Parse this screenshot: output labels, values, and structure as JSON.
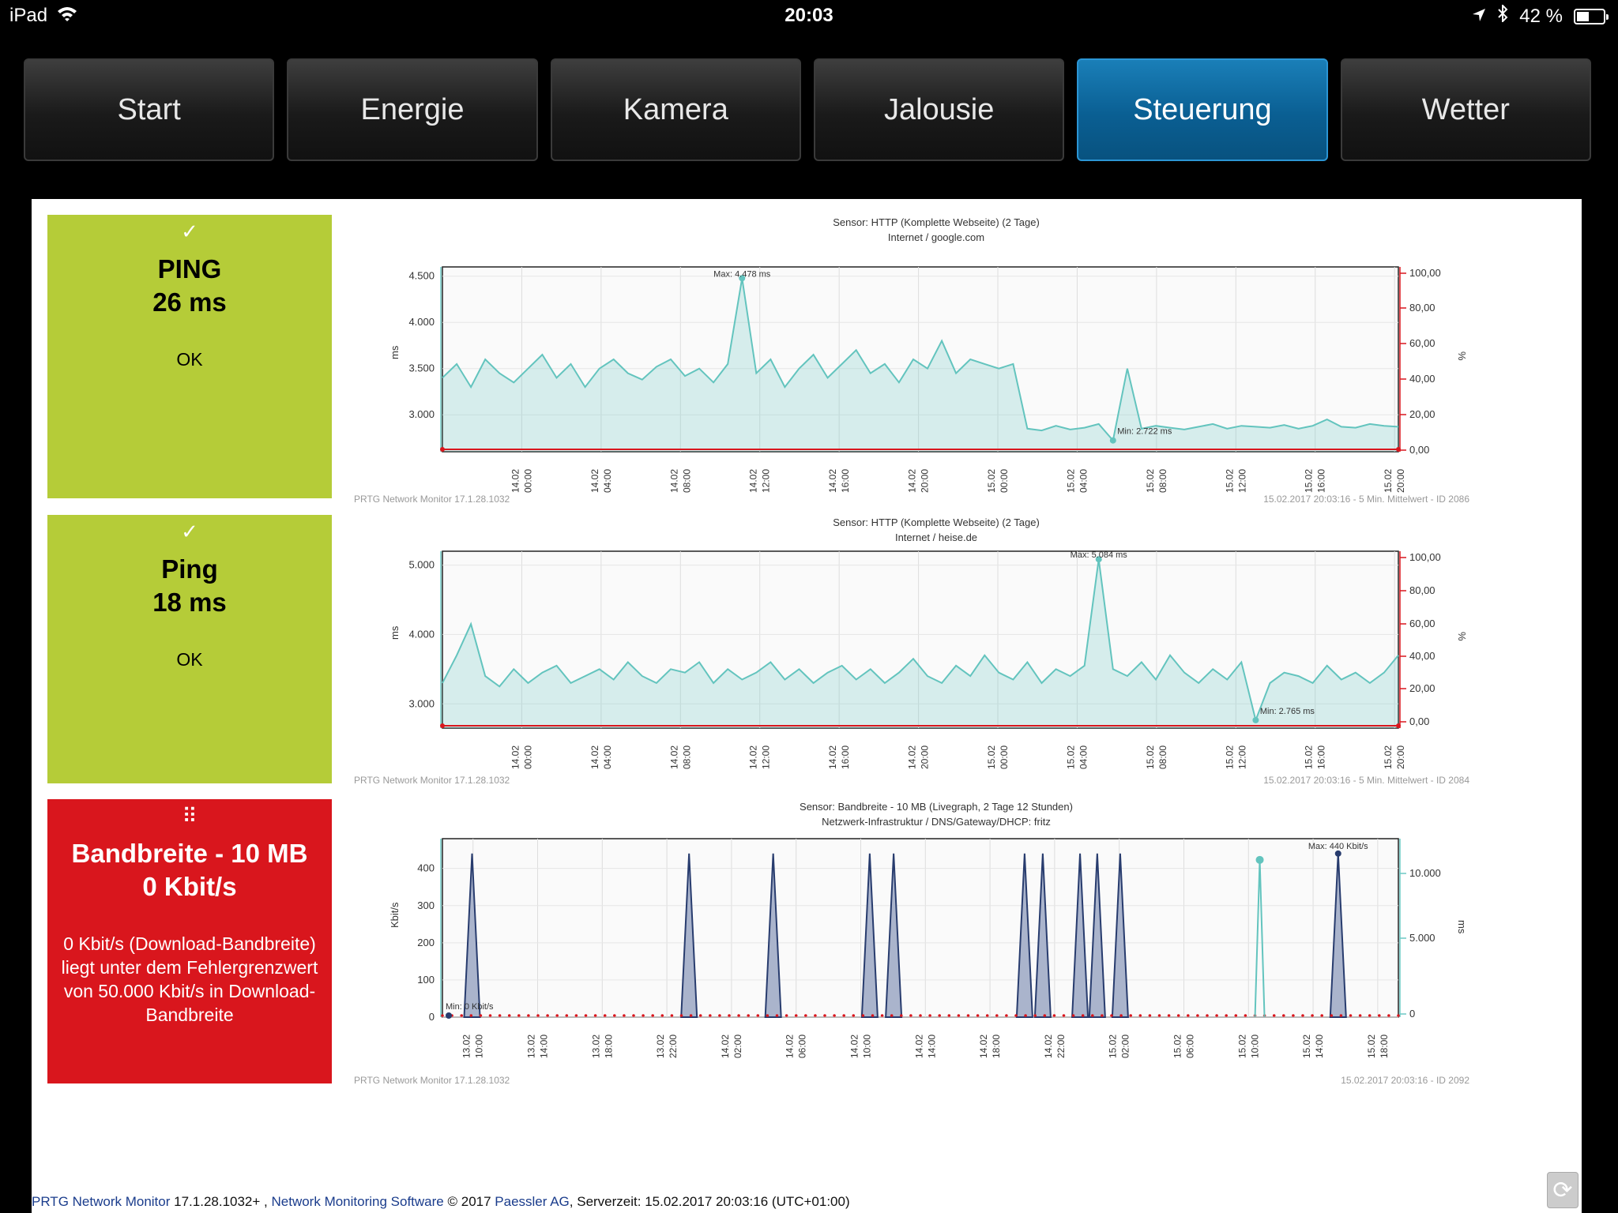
{
  "statusbar": {
    "device": "iPad",
    "time": "20:03",
    "battery": "42 %",
    "battery_level": 0.42
  },
  "nav": {
    "items": [
      "Start",
      "Energie",
      "Kamera",
      "Jalousie",
      "Steuerung",
      "Wetter"
    ],
    "active_index": 4
  },
  "tiles": [
    {
      "mark": "✓",
      "name": "PING",
      "value": "26 ms",
      "message": "OK",
      "color": "#b5cc38"
    },
    {
      "mark": "⠿",
      "name": "Ping",
      "value": "18 ms",
      "message": "OK",
      "color": "#b5cc38"
    },
    {
      "mark": "⠿",
      "name": "Bandbreite - 10 MB",
      "value": "0 Kbit/s",
      "message": "0 Kbit/s (Download-Bandbreite) liegt unter dem Fehlergrenzwert von 50.000 Kbit/s in Download-Bandbreite",
      "color": "#d9161d"
    }
  ],
  "chart_data": [
    {
      "type": "area",
      "title": "Sensor: HTTP (Komplette Webseite) (2 Tage)",
      "subtitle": "Internet / google.com",
      "ylabel": "ms",
      "ylabel_right": "%",
      "ylim": [
        2600,
        4600
      ],
      "yticks": [
        "4.500",
        "4.000",
        "3.500",
        "3.000"
      ],
      "yticks_values": [
        4500,
        4000,
        3500,
        3000
      ],
      "yticks_right": [
        "100,00",
        "80,00",
        "60,00",
        "40,00",
        "20,00",
        "0,00"
      ],
      "x_ticks": [
        "14.02 00:00",
        "14.02 04:00",
        "14.02 08:00",
        "14.02 12:00",
        "14.02 16:00",
        "14.02 20:00",
        "15.02 00:00",
        "15.02 04:00",
        "15.02 08:00",
        "15.02 12:00",
        "15.02 16:00",
        "15.02 20:00"
      ],
      "max_label": "Max: 4.478 ms",
      "min_label": "Min: 2.722 ms",
      "footer_left": "PRTG Network Monitor 17.1.28.1032",
      "footer_right": "15.02.2017 20:03:16 - 5 Min. Mittelwert - ID 2086",
      "series": [
        {
          "values": [
            3400,
            3550,
            3300,
            3600,
            3450,
            3350,
            3500,
            3650,
            3400,
            3550,
            3300,
            3500,
            3600,
            3450,
            3380,
            3520,
            3600,
            3420,
            3500,
            3350,
            3550,
            4478,
            3450,
            3600,
            3300,
            3500,
            3650,
            3400,
            3550,
            3700,
            3450,
            3550,
            3350,
            3600,
            3500,
            3800,
            3450,
            3600,
            3550,
            3500,
            3550,
            2850,
            2830,
            2880,
            2840,
            2860,
            2900,
            2722,
            3500,
            2850,
            2880,
            2860,
            2840,
            2870,
            2900,
            2850,
            2880,
            2870,
            2860,
            2890,
            2850,
            2880,
            2950,
            2870,
            2860,
            2900,
            2880,
            2870
          ]
        }
      ]
    },
    {
      "type": "area",
      "title": "Sensor: HTTP (Komplette Webseite) (2 Tage)",
      "subtitle": "Internet / heise.de",
      "ylabel": "ms",
      "ylabel_right": "%",
      "ylim": [
        2650,
        5200
      ],
      "yticks": [
        "5.000",
        "4.000",
        "3.000"
      ],
      "yticks_values": [
        5000,
        4000,
        3000
      ],
      "yticks_right": [
        "100,00",
        "80,00",
        "60,00",
        "40,00",
        "20,00",
        "0,00"
      ],
      "x_ticks": [
        "14.02 00:00",
        "14.02 04:00",
        "14.02 08:00",
        "14.02 12:00",
        "14.02 16:00",
        "14.02 20:00",
        "15.02 00:00",
        "15.02 04:00",
        "15.02 08:00",
        "15.02 12:00",
        "15.02 16:00",
        "15.02 20:00"
      ],
      "max_label": "Max: 5.084 ms",
      "min_label": "Min: 2.765 ms",
      "footer_left": "PRTG Network Monitor 17.1.28.1032",
      "footer_right": "15.02.2017 20:03:16 - 5 Min. Mittelwert - ID 2084",
      "series": [
        {
          "values": [
            3300,
            3700,
            4150,
            3400,
            3250,
            3500,
            3300,
            3450,
            3550,
            3300,
            3400,
            3500,
            3350,
            3600,
            3400,
            3300,
            3500,
            3450,
            3600,
            3300,
            3500,
            3350,
            3450,
            3600,
            3350,
            3500,
            3300,
            3450,
            3550,
            3350,
            3500,
            3300,
            3450,
            3650,
            3400,
            3300,
            3550,
            3400,
            3700,
            3450,
            3350,
            3600,
            3300,
            3500,
            3400,
            3550,
            5084,
            3500,
            3400,
            3600,
            3350,
            3700,
            3450,
            3300,
            3500,
            3350,
            3600,
            2765,
            3300,
            3450,
            3400,
            3300,
            3550,
            3350,
            3450,
            3300,
            3450,
            3700
          ]
        }
      ]
    },
    {
      "type": "area",
      "title": "Sensor: Bandbreite - 10 MB (Livegraph, 2 Tage 12 Stunden)",
      "subtitle": "Netzwerk-Infrastruktur / DNS/Gateway/DHCP: fritz",
      "ylabel": "Kbit/s",
      "ylabel_right": "ms",
      "ylim": [
        0,
        480
      ],
      "yticks": [
        "400",
        "300",
        "200",
        "100",
        "0"
      ],
      "yticks_values": [
        400,
        300,
        200,
        100,
        0
      ],
      "yticks_right": [
        "10.000",
        "5.000",
        "0"
      ],
      "x_ticks": [
        "13.02 10:00",
        "13.02 14:00",
        "13.02 18:00",
        "13.02 22:00",
        "14.02 02:00",
        "14.02 06:00",
        "14.02 10:00",
        "14.02 14:00",
        "14.02 18:00",
        "14.02 22:00",
        "15.02 02:00",
        "15.02 06:00",
        "15.02 10:00",
        "15.02 14:00",
        "15.02 18:00"
      ],
      "max_label": "Max: 440 Kbit/s",
      "min_label": "Min: 0 Kbit/s",
      "footer_left": "PRTG Network Monitor 17.1.28.1032",
      "footer_right": "15.02.2017 20:03:16 - ID 2092",
      "spike_positions": [
        0.031,
        0.258,
        0.346,
        0.447,
        0.472,
        0.609,
        0.628,
        0.667,
        0.685,
        0.709,
        0.937
      ],
      "spike_value": 440,
      "ping_spike_position": 0.855,
      "ping_spike_value": 440
    }
  ],
  "footer": {
    "product": "PRTG Network Monitor",
    "version": " 17.1.28.1032+ , ",
    "software": "Network Monitoring Software",
    "copyright": " © 2017 ",
    "company": "Paessler AG",
    "server_time": ", Serverzeit: 15.02.2017 20:03:16 (UTC+01:00)"
  }
}
